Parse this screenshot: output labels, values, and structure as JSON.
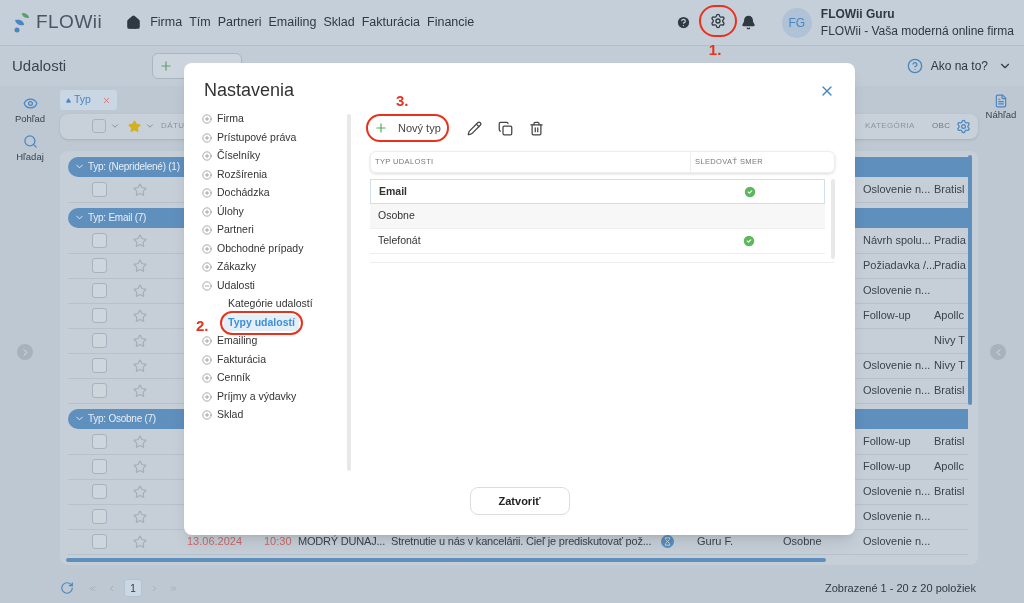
{
  "header": {
    "logo": "FLOWii",
    "nav": [
      "Firma",
      "Tím",
      "Partneri",
      "Emailing",
      "Sklad",
      "Fakturácia",
      "Financie"
    ],
    "user": {
      "initials": "FG",
      "name": "FLOWii Guru",
      "company": "FLOWii - Vaša moderná online firma"
    }
  },
  "toolbar": {
    "title": "Udalosti",
    "help": "Ako na to?"
  },
  "side_left": [
    {
      "label": "Pohľad",
      "kind": "view"
    },
    {
      "label": "Hľadaj",
      "kind": "search"
    }
  ],
  "side_right": {
    "label": "Náhľad"
  },
  "filter_chip": {
    "label": "Typ"
  },
  "table": {
    "all_checked": false,
    "columns": [
      "DÁTU",
      "KATEGÓRIA",
      "OBC"
    ],
    "groups": [
      {
        "label": "Typ: (Nepridelené) (1)",
        "expanded": true,
        "rows": [
          {
            "kind": "partial",
            "checked": false,
            "category": "Oslovenie n...",
            "column_11": "Bratisl"
          }
        ]
      },
      {
        "label": "Typ: Email (7)",
        "expanded": true,
        "rows": [
          {
            "kind": "partial",
            "checked": false,
            "category": "Návrh spolu...",
            "column_11": "Pradia"
          },
          {
            "kind": "partial",
            "checked": false,
            "category": "Požiadavka /...",
            "column_11": "Pradia"
          },
          {
            "kind": "partial",
            "checked": false,
            "category": "Oslovenie n..."
          },
          {
            "kind": "partial",
            "checked": false,
            "category": "Follow-up",
            "column_11": "Apollc"
          },
          {
            "kind": "partial",
            "checked": false,
            "column_11": "Nivy T"
          },
          {
            "kind": "partial",
            "checked": false,
            "category": "Oslovenie n...",
            "column_11": "Nivy T"
          },
          {
            "kind": "partial",
            "checked": false,
            "category": "Oslovenie n...",
            "column_11": "Bratisl"
          }
        ]
      },
      {
        "label": "Typ: Osobne (7)",
        "expanded": true,
        "rows": [
          {
            "kind": "partial",
            "checked": false,
            "category": "Follow-up",
            "column_11": "Bratisl"
          },
          {
            "kind": "partial",
            "checked": false,
            "category": "Follow-up",
            "column_11": "Apollc"
          },
          {
            "kind": "partial",
            "checked": false,
            "category": "Oslovenie n...",
            "column_11": "Bratisl"
          },
          {
            "kind": "partial",
            "checked": false,
            "category": "Oslovenie n..."
          },
          {
            "kind": "full",
            "checked": false,
            "date": "13.06.2024",
            "time": "10:30",
            "company": "MODRÝ DUNAJ...",
            "subject": "Stretnutie u nás v kancelárii. Cieľ je prediskutovať pož...",
            "owner": "Guru F.",
            "type": "Osobne",
            "category": "Oslovenie n..."
          }
        ]
      }
    ]
  },
  "pagination": {
    "pages": [
      {
        "label": "1",
        "selected": true
      }
    ],
    "summary": "Zobrazené 1 - 20 z 20 položiek"
  },
  "modal": {
    "title": "Nastavenia",
    "nav": [
      {
        "label": "Firma",
        "expanded": false
      },
      {
        "label": "Prístupové práva",
        "expanded": false
      },
      {
        "label": "Číselníky",
        "expanded": false
      },
      {
        "label": "Rozšírenia",
        "expanded": false
      },
      {
        "label": "Dochádzka",
        "expanded": false
      },
      {
        "label": "Úlohy",
        "expanded": false
      },
      {
        "label": "Partneri",
        "expanded": false
      },
      {
        "label": "Obchodné prípady",
        "expanded": false
      },
      {
        "label": "Zákazky",
        "expanded": false
      },
      {
        "label": "Udalosti",
        "expanded": true,
        "children": [
          {
            "label": "Kategórie udalostí",
            "selected": false
          },
          {
            "label": "Typy udalostí",
            "selected": true
          }
        ]
      },
      {
        "label": "Emailing",
        "expanded": false
      },
      {
        "label": "Fakturácia",
        "expanded": false
      },
      {
        "label": "Cenník",
        "expanded": false
      },
      {
        "label": "Príjmy a výdavky",
        "expanded": false
      },
      {
        "label": "Sklad",
        "expanded": false
      }
    ],
    "new_label": "Nový typ",
    "columns": [
      "TYP UDALOSTI",
      "SLEDOVAŤ SMER"
    ],
    "rows": [
      {
        "name": "Email",
        "track_direction": true,
        "selected": true
      },
      {
        "name": "Osobne",
        "track_direction": false,
        "selected": false
      },
      {
        "name": "Telefonát",
        "track_direction": true,
        "selected": false
      }
    ],
    "close_label": "Zatvoriť"
  },
  "annotations": [
    "1.",
    "2.",
    "3."
  ]
}
